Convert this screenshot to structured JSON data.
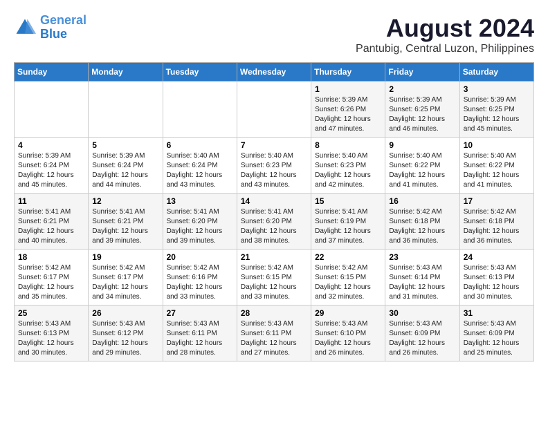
{
  "header": {
    "logo_line1": "General",
    "logo_line2": "Blue",
    "main_title": "August 2024",
    "subtitle": "Pantubig, Central Luzon, Philippines"
  },
  "calendar": {
    "days_of_week": [
      "Sunday",
      "Monday",
      "Tuesday",
      "Wednesday",
      "Thursday",
      "Friday",
      "Saturday"
    ],
    "weeks": [
      [
        {
          "day": "",
          "info": ""
        },
        {
          "day": "",
          "info": ""
        },
        {
          "day": "",
          "info": ""
        },
        {
          "day": "",
          "info": ""
        },
        {
          "day": "1",
          "info": "Sunrise: 5:39 AM\nSunset: 6:26 PM\nDaylight: 12 hours\nand 47 minutes."
        },
        {
          "day": "2",
          "info": "Sunrise: 5:39 AM\nSunset: 6:25 PM\nDaylight: 12 hours\nand 46 minutes."
        },
        {
          "day": "3",
          "info": "Sunrise: 5:39 AM\nSunset: 6:25 PM\nDaylight: 12 hours\nand 45 minutes."
        }
      ],
      [
        {
          "day": "4",
          "info": "Sunrise: 5:39 AM\nSunset: 6:24 PM\nDaylight: 12 hours\nand 45 minutes."
        },
        {
          "day": "5",
          "info": "Sunrise: 5:39 AM\nSunset: 6:24 PM\nDaylight: 12 hours\nand 44 minutes."
        },
        {
          "day": "6",
          "info": "Sunrise: 5:40 AM\nSunset: 6:24 PM\nDaylight: 12 hours\nand 43 minutes."
        },
        {
          "day": "7",
          "info": "Sunrise: 5:40 AM\nSunset: 6:23 PM\nDaylight: 12 hours\nand 43 minutes."
        },
        {
          "day": "8",
          "info": "Sunrise: 5:40 AM\nSunset: 6:23 PM\nDaylight: 12 hours\nand 42 minutes."
        },
        {
          "day": "9",
          "info": "Sunrise: 5:40 AM\nSunset: 6:22 PM\nDaylight: 12 hours\nand 41 minutes."
        },
        {
          "day": "10",
          "info": "Sunrise: 5:40 AM\nSunset: 6:22 PM\nDaylight: 12 hours\nand 41 minutes."
        }
      ],
      [
        {
          "day": "11",
          "info": "Sunrise: 5:41 AM\nSunset: 6:21 PM\nDaylight: 12 hours\nand 40 minutes."
        },
        {
          "day": "12",
          "info": "Sunrise: 5:41 AM\nSunset: 6:21 PM\nDaylight: 12 hours\nand 39 minutes."
        },
        {
          "day": "13",
          "info": "Sunrise: 5:41 AM\nSunset: 6:20 PM\nDaylight: 12 hours\nand 39 minutes."
        },
        {
          "day": "14",
          "info": "Sunrise: 5:41 AM\nSunset: 6:20 PM\nDaylight: 12 hours\nand 38 minutes."
        },
        {
          "day": "15",
          "info": "Sunrise: 5:41 AM\nSunset: 6:19 PM\nDaylight: 12 hours\nand 37 minutes."
        },
        {
          "day": "16",
          "info": "Sunrise: 5:42 AM\nSunset: 6:18 PM\nDaylight: 12 hours\nand 36 minutes."
        },
        {
          "day": "17",
          "info": "Sunrise: 5:42 AM\nSunset: 6:18 PM\nDaylight: 12 hours\nand 36 minutes."
        }
      ],
      [
        {
          "day": "18",
          "info": "Sunrise: 5:42 AM\nSunset: 6:17 PM\nDaylight: 12 hours\nand 35 minutes."
        },
        {
          "day": "19",
          "info": "Sunrise: 5:42 AM\nSunset: 6:17 PM\nDaylight: 12 hours\nand 34 minutes."
        },
        {
          "day": "20",
          "info": "Sunrise: 5:42 AM\nSunset: 6:16 PM\nDaylight: 12 hours\nand 33 minutes."
        },
        {
          "day": "21",
          "info": "Sunrise: 5:42 AM\nSunset: 6:15 PM\nDaylight: 12 hours\nand 33 minutes."
        },
        {
          "day": "22",
          "info": "Sunrise: 5:42 AM\nSunset: 6:15 PM\nDaylight: 12 hours\nand 32 minutes."
        },
        {
          "day": "23",
          "info": "Sunrise: 5:43 AM\nSunset: 6:14 PM\nDaylight: 12 hours\nand 31 minutes."
        },
        {
          "day": "24",
          "info": "Sunrise: 5:43 AM\nSunset: 6:13 PM\nDaylight: 12 hours\nand 30 minutes."
        }
      ],
      [
        {
          "day": "25",
          "info": "Sunrise: 5:43 AM\nSunset: 6:13 PM\nDaylight: 12 hours\nand 30 minutes."
        },
        {
          "day": "26",
          "info": "Sunrise: 5:43 AM\nSunset: 6:12 PM\nDaylight: 12 hours\nand 29 minutes."
        },
        {
          "day": "27",
          "info": "Sunrise: 5:43 AM\nSunset: 6:11 PM\nDaylight: 12 hours\nand 28 minutes."
        },
        {
          "day": "28",
          "info": "Sunrise: 5:43 AM\nSunset: 6:11 PM\nDaylight: 12 hours\nand 27 minutes."
        },
        {
          "day": "29",
          "info": "Sunrise: 5:43 AM\nSunset: 6:10 PM\nDaylight: 12 hours\nand 26 minutes."
        },
        {
          "day": "30",
          "info": "Sunrise: 5:43 AM\nSunset: 6:09 PM\nDaylight: 12 hours\nand 26 minutes."
        },
        {
          "day": "31",
          "info": "Sunrise: 5:43 AM\nSunset: 6:09 PM\nDaylight: 12 hours\nand 25 minutes."
        }
      ]
    ]
  }
}
